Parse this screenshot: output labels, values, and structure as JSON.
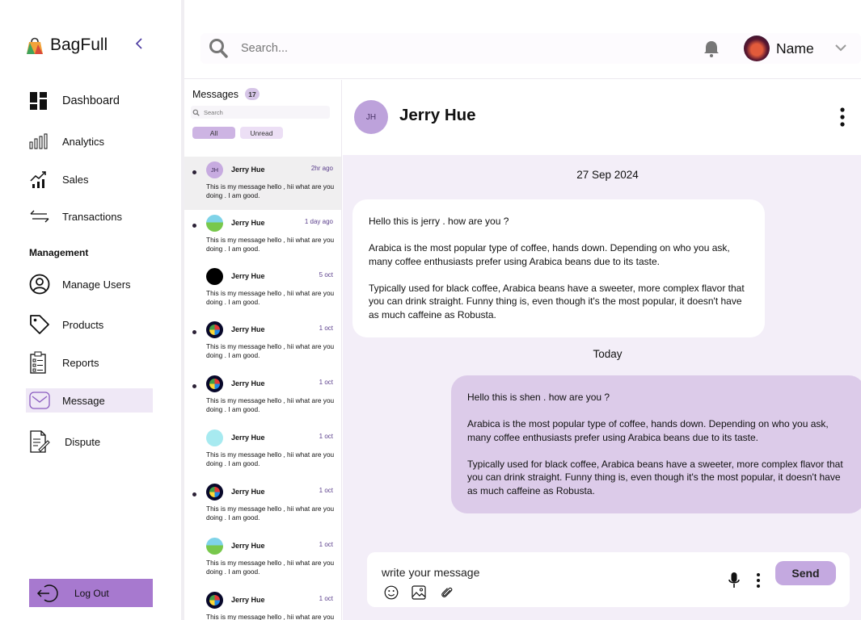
{
  "brand": {
    "name": "BagFull"
  },
  "sidebar": {
    "items": [
      {
        "label": "Dashboard"
      },
      {
        "label": "Analytics"
      },
      {
        "label": "Sales"
      },
      {
        "label": "Transactions"
      },
      {
        "label": "Manage Users"
      },
      {
        "label": "Products"
      },
      {
        "label": "Reports"
      },
      {
        "label": "Message"
      },
      {
        "label": "Dispute"
      }
    ],
    "section_title": "Management",
    "logout_label": "Log Out"
  },
  "topbar": {
    "search_placeholder": "Search...",
    "user_name": "Name"
  },
  "messages": {
    "title": "Messages",
    "count": "17",
    "search_placeholder": "Search",
    "filter_all": "All",
    "filter_unread": "Unread",
    "conversations": [
      {
        "name": "Jerry Hue",
        "time": "2hr ago",
        "preview": "This is my message hello , hii  what are you doing . I am good.",
        "avatar_text": "JH"
      },
      {
        "name": "Jerry Hue",
        "time": "1 day ago",
        "preview": "This is my message hello , hii  what are you doing . I am good.",
        "avatar_text": ""
      },
      {
        "name": "Jerry Hue",
        "time": "5 oct",
        "preview": "This is my message hello , hii  what are you doing . I am good.",
        "avatar_text": ""
      },
      {
        "name": "Jerry Hue",
        "time": "1 oct",
        "preview": "This is my message hello , hii  what are you doing . I am good.",
        "avatar_text": ""
      },
      {
        "name": "Jerry Hue",
        "time": "1 oct",
        "preview": "This is my message hello , hii  what are you doing . I am good.",
        "avatar_text": ""
      },
      {
        "name": "Jerry Hue",
        "time": "1 oct",
        "preview": "This is my message hello , hii  what are you doing . I am good.",
        "avatar_text": ""
      },
      {
        "name": "Jerry Hue",
        "time": "1 oct",
        "preview": "This is my message hello , hii  what are you doing . I am good.",
        "avatar_text": ""
      },
      {
        "name": "Jerry Hue",
        "time": "1 oct",
        "preview": "This is my message hello , hii  what are you doing . I am good.",
        "avatar_text": ""
      },
      {
        "name": "Jerry Hue",
        "time": "1 oct",
        "preview": "This is my message hello , hii  what are you",
        "avatar_text": ""
      }
    ]
  },
  "chat": {
    "avatar_text": "JH",
    "name": "Jerry Hue",
    "date_1": "27 Sep 2024",
    "date_2": "Today",
    "incoming": {
      "p1": "Hello this is jerry . how are you ?",
      "p2": "Arabica is the most popular type of coffee, hands down. Depending on who you ask, many coffee enthusiasts prefer using Arabica beans due to its taste.",
      "p3": "Typically used for black coffee, Arabica beans have a sweeter, more complex flavor that you can drink straight. Funny thing is, even though it's the most popular, it doesn't have as much caffeine as Robusta."
    },
    "outgoing": {
      "p1": "Hello this is shen . how are you ?",
      "p2": "Arabica is the most popular type of coffee, hands down. Depending on who you ask, many coffee enthusiasts prefer using Arabica beans due to its taste.",
      "p3": "Typically used for black coffee, Arabica beans have a sweeter, more complex flavor that you can drink straight. Funny thing is, even though it's the most popular, it doesn't have as much caffeine as Robusta."
    },
    "composer_placeholder": "write your message",
    "send_label": "Send"
  },
  "colors": {
    "accent": "#a779cf",
    "active_nav": "#efe8f6",
    "chat_bg": "#f3eef8",
    "outgoing_bubble": "#dccbe9",
    "send_button": "#c4a9e0"
  }
}
